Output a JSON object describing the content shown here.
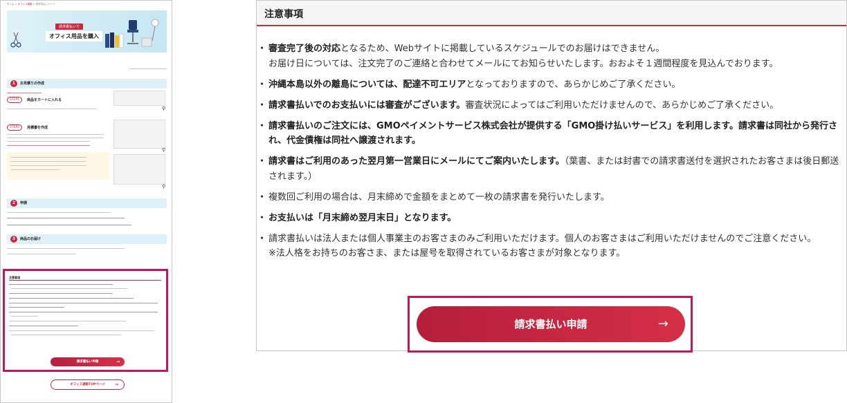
{
  "thumbnail": {
    "breadcrumb": [
      "ホーム",
      "オフィス通販",
      "請求書払いページ"
    ],
    "hero_badge": "請求書払いで",
    "hero_title": "オフィス用品を購入",
    "sections": [
      {
        "num": "1",
        "label": "お見積りの作成"
      },
      {
        "num": "2",
        "label": "申請"
      },
      {
        "num": "3",
        "label": "商品のお届け"
      }
    ],
    "step1_tag": "STEP1",
    "step1_name": "商品をカートに入れる",
    "step2_tag": "STEP2",
    "step2_name": "見積書を作成",
    "notes_heading": "注意事項",
    "apply_label": "請求書払い申請",
    "top_label": "オフィス通販TOPページ",
    "arrow": "→"
  },
  "notices": {
    "title": "注意事項",
    "items": [
      {
        "bold": "審査完了後の対応",
        "text": "となるため、Webサイトに掲載しているスケジュールでのお届けはできません。",
        "sub": "お届け日については、注文完了のご連絡と合わせてメールにてお知らせいたします。おおよそ１週間程度を見込んでおります。"
      },
      {
        "bold": "沖縄本島以外の離島については、配達不可エリア",
        "text": "となっておりますので、あらかじめご了承ください。",
        "sub": ""
      },
      {
        "bold": "請求書払いでのお支払いには審査がございます。",
        "text": "審査状況によってはご利用いただけませんので、あらかじめご了承ください。",
        "sub": ""
      },
      {
        "bold": "請求書払いのご注文には、GMOペイメントサービス株式会社が提供する「GMO掛け払いサービス」を利用します。請求書は同社から発行され、代金債権は同社へ譲渡されます。",
        "text": "",
        "sub": ""
      },
      {
        "bold": "請求書はご利用のあった翌月第一営業日にメールにてご案内いたします。",
        "text": "（葉書、または封書での請求書送付を選択されたお客さまは後日郵送されます。）",
        "sub": ""
      },
      {
        "bold": "",
        "text": "複数回ご利用の場合は、月末締めで金額をまとめて一枚の請求書を発行いたします。",
        "sub": ""
      },
      {
        "bold": "お支払いは「月末締め翌月末日」となります。",
        "text": "",
        "sub": ""
      },
      {
        "bold": "",
        "text": "請求書払いは法人または個人事業主のお客さまのみご利用いただけます。個人のお客さまはご利用いただけませんのでご注意ください。",
        "sub": "※法人格をお持ちのお客さま、または屋号を取得されているお客さまが対象となります。"
      }
    ]
  },
  "apply_button": {
    "label": "請求書払い申請",
    "arrow": "→"
  },
  "colors": {
    "accent": "#c9283e",
    "highlight_frame": "#c2185b",
    "header_bg": "#f5f5f5",
    "hero_bg": "#dff1f8"
  }
}
